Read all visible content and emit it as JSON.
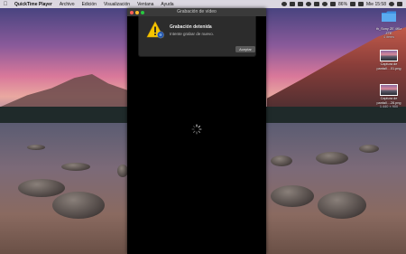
{
  "menubar": {
    "apple_icon": "apple-logo-icon",
    "app_name": "QuickTime Player",
    "menus": [
      "Archivo",
      "Edición",
      "Visualización",
      "Ventana",
      "Ayuda"
    ],
    "battery": "86%",
    "clock": "Mie 15:58"
  },
  "window": {
    "title": "Grabación de vídeo"
  },
  "alert": {
    "icon": "warning-icon",
    "title": "Grabación detenida",
    "message": "Intente grabar de nuevo.",
    "button_label": "Aceptar"
  },
  "desktop": {
    "items": [
      {
        "icon": "folder-icon",
        "label_line1": "th_Sony ZE 4Klz",
        "label_line2": "ZTE",
        "label_line3": "4 items"
      },
      {
        "icon": "image-thumbnail-icon",
        "label_line1": "Captura de",
        "label_line2": "pantall....01.png",
        "label_line3": ""
      },
      {
        "icon": "image-thumbnail-icon",
        "label_line1": "Captura de",
        "label_line2": "pantall....28.png",
        "label_line3": "1.440 × 900"
      }
    ]
  },
  "colors": {
    "window_bg": "#000000",
    "sheet_bg": "#2c2c2c",
    "warning_yellow": "#f5c400"
  }
}
